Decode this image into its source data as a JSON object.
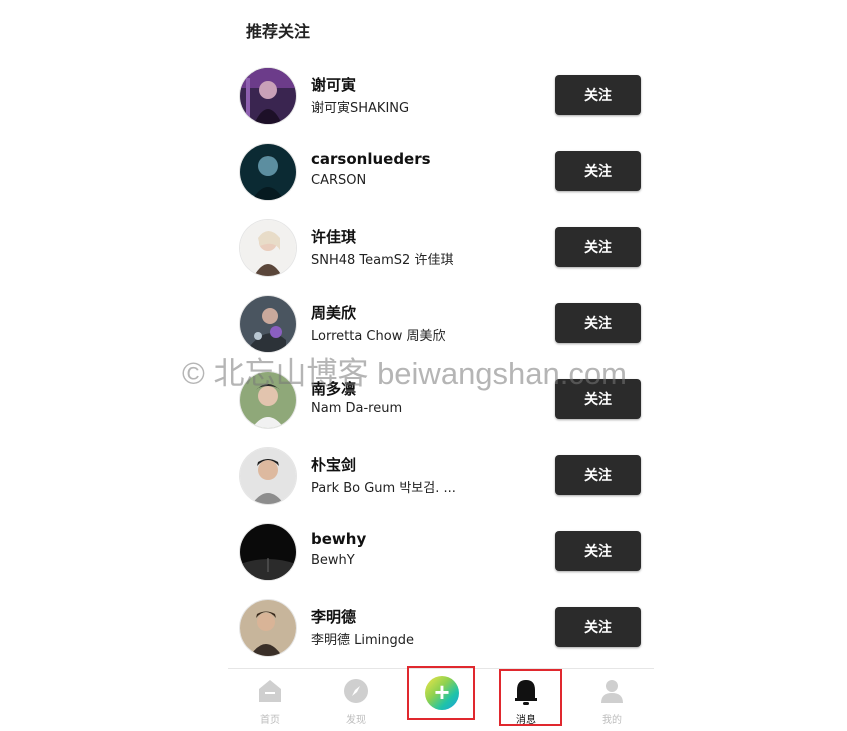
{
  "section": {
    "title": "推荐关注"
  },
  "follow_label": "关注",
  "users": [
    {
      "name": "谢可寅",
      "subtitle": "谢可寅SHAKING"
    },
    {
      "name": "carsonlueders",
      "subtitle": "CARSON"
    },
    {
      "name": "许佳琪",
      "subtitle": "SNH48 TeamS2 许佳琪"
    },
    {
      "name": "周美欣",
      "subtitle": "Lorretta Chow 周美欣"
    },
    {
      "name": "南多凛",
      "subtitle": "Nam Da-reum"
    },
    {
      "name": "朴宝剑",
      "subtitle": "Park Bo Gum  박보검. ..."
    },
    {
      "name": "bewhy",
      "subtitle": "BewhY"
    },
    {
      "name": "李明德",
      "subtitle": "李明德 Limingde"
    }
  ],
  "watermark": "© 北忘山博客 beiwangshan.com",
  "tabbar": {
    "home": "首页",
    "discover": "发现",
    "add": "+",
    "messages": "消息",
    "profile": "我的"
  },
  "colors": {
    "follow_button_bg": "#2b2b2b",
    "highlight_border": "#e0282e",
    "tab_inactive": "#bdbdbd"
  }
}
